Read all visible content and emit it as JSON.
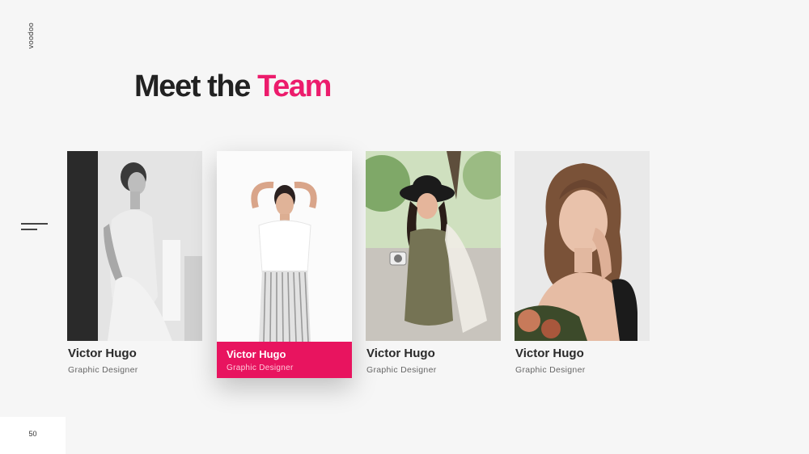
{
  "brand": "voodoo",
  "title": {
    "main": "Meet the",
    "accent": "Team"
  },
  "team": [
    {
      "name": "Victor Hugo",
      "role": "Graphic Designer"
    },
    {
      "name": "Victor Hugo",
      "role": "Graphic Designer"
    },
    {
      "name": "Victor Hugo",
      "role": "Graphic Designer"
    },
    {
      "name": "Victor Hugo",
      "role": "Graphic Designer"
    }
  ],
  "page_number": "50",
  "colors": {
    "accent": "#ec1c6c",
    "background": "#f6f6f6",
    "text": "#222222"
  },
  "icons": [
    "menu-icon"
  ]
}
